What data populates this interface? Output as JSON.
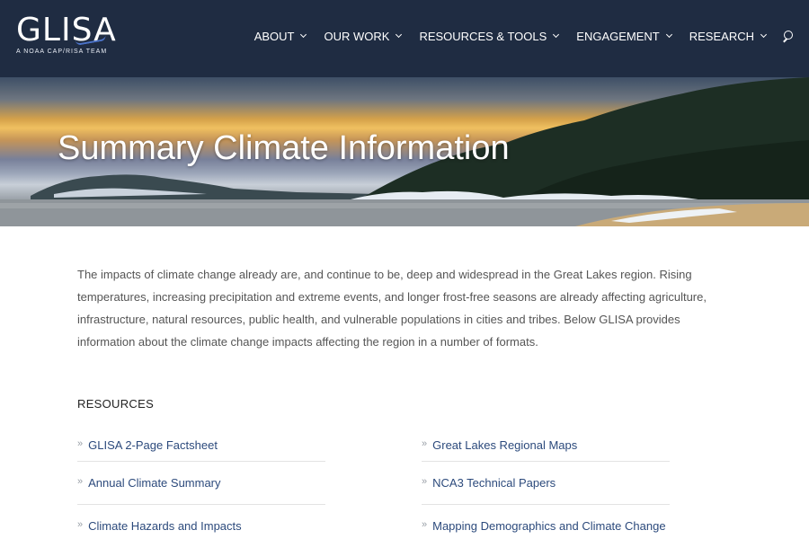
{
  "header": {
    "logo_text": "GLISA",
    "logo_subtitle": "A NOAA CAP/RISA TEAM",
    "background_color": "#1f2c42",
    "nav": [
      {
        "label": "ABOUT"
      },
      {
        "label": "OUR WORK"
      },
      {
        "label": "RESOURCES & TOOLS"
      },
      {
        "label": "ENGAGEMENT"
      },
      {
        "label": "RESEARCH"
      }
    ],
    "search_icon": "search-icon"
  },
  "hero": {
    "title": "Summary Climate Information"
  },
  "intro": {
    "text": "The impacts of climate change already are, and continue to be, deep and widespread in the Great Lakes region. Rising temperatures, increasing precipitation and extreme events, and longer frost-free seasons are already affecting agriculture, infrastructure, natural resources, public health, and vulnerable populations in cities and tribes. Below GLISA provides information about the climate change impacts affecting the region in a number of formats."
  },
  "resources": {
    "heading": "RESOURCES",
    "bullet": "»",
    "link_color": "#2c4a7c",
    "left": [
      {
        "label": "GLISA 2-Page Factsheet"
      },
      {
        "label": "Annual Climate Summary"
      },
      {
        "label": "Climate Hazards and Impacts"
      }
    ],
    "right": [
      {
        "label": "Great Lakes Regional Maps"
      },
      {
        "label": "NCA3 Technical Papers"
      },
      {
        "label": "Mapping Demographics and Climate Change"
      }
    ]
  }
}
